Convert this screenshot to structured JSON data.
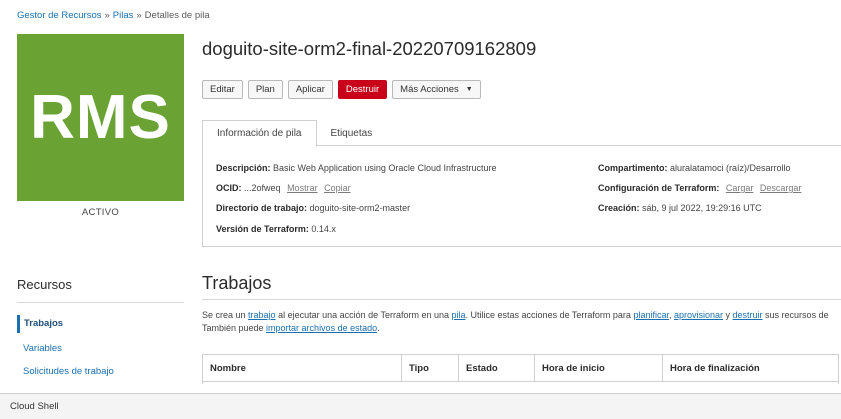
{
  "breadcrumb": {
    "items": [
      "Gestor de Recursos",
      "Pilas",
      "Detalles de pila"
    ],
    "separator": "»"
  },
  "logo": {
    "text": "RMS",
    "color": "#6aa333"
  },
  "status": "ACTIVO",
  "title": "doguito-site-orm2-final-20220709162809",
  "actions": {
    "edit": "Editar",
    "plan": "Plan",
    "apply": "Aplicar",
    "destroy": "Destruir",
    "more": "Más Acciones",
    "more_icon": "caret-down-icon"
  },
  "tabs": [
    "Información de pila",
    "Etiquetas"
  ],
  "info": {
    "description_label": "Descripción:",
    "description_value": "Basic Web Application using Oracle Cloud Infrastructure",
    "ocid_label": "OCID:",
    "ocid_value": "...2ofweq",
    "ocid_show": "Mostrar",
    "ocid_copy": "Copiar",
    "workdir_label": "Directorio de trabajo:",
    "workdir_value": "doguito-site-orm2-master",
    "tf_version_label": "Versión de Terraform:",
    "tf_version_value": "0.14.x",
    "compartment_label": "Compartimento:",
    "compartment_value": "aluralatamoci (raíz)/Desarrollo",
    "tf_config_label": "Configuración de Terraform:",
    "tf_config_upload": "Cargar",
    "tf_config_download": "Descargar",
    "created_label": "Creación:",
    "created_value": "sáb, 9 jul 2022, 19:29:16 UTC"
  },
  "sidebar": {
    "heading": "Recursos",
    "items": [
      "Trabajos",
      "Variables",
      "Solicitudes de trabajo"
    ]
  },
  "jobs": {
    "title": "Trabajos",
    "desc": {
      "t1": "Se crea un ",
      "l_job": "trabajo",
      "t2": " al ejecutar una acción de Terraform en una ",
      "l_stack": "pila",
      "t3": ". Utilice estas acciones de Terraform para ",
      "l_plan": "planificar",
      "t4": ", ",
      "l_provision": "aprovisionar",
      "t5": " y ",
      "l_destroy": "destruir",
      "t6": " sus recursos de",
      "t7": "También puede ",
      "l_import": "importar archivos de estado",
      "t8": "."
    },
    "columns": [
      "Nombre",
      "Tipo",
      "Estado",
      "Hora de inicio",
      "Hora de finalización"
    ]
  },
  "footer": {
    "label": "Cloud Shell"
  },
  "colors": {
    "link": "#1a6fb0",
    "danger": "#c9001a",
    "accent_green": "#6aa333"
  }
}
